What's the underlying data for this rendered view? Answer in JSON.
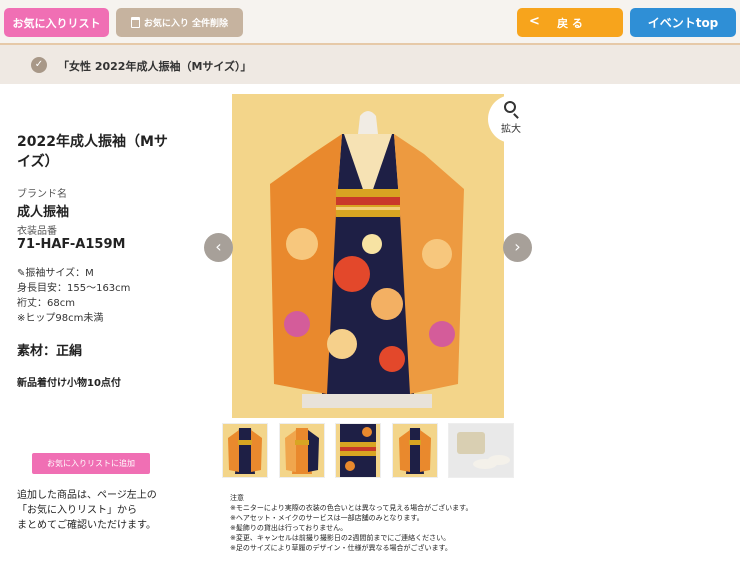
{
  "header": {
    "favorites_label": "お気に入りリスト",
    "clear_all_label": "お気に入り 全件削除",
    "back_label": "戻 る",
    "back_chevron": "<",
    "event_top_label": "イベントtop"
  },
  "breadcrumb": {
    "check": "✓",
    "text": "「女性 2022年成人振袖（Mサイズ）」"
  },
  "product": {
    "title": "2022年成人振袖（Mサイズ）",
    "brand_label": "ブランド名",
    "brand": "成人振袖",
    "code_label": "衣装品番",
    "code": "71-HAF-A159M",
    "specs": [
      "✎振袖サイズ：M",
      "身長目安：155〜163cm",
      "裄丈：68cm",
      "※ヒップ98cm未満"
    ],
    "material": "素材：正絹",
    "includes": "新品着付け小物10点付"
  },
  "gallery": {
    "zoom_label": "拡大",
    "prev": "‹",
    "next": "›",
    "thumbnails": [
      "kimono-front",
      "kimono-front-2",
      "kimono-obi",
      "kimono-full",
      "zori-bag"
    ]
  },
  "favorites": {
    "add_button": "お気に入りリストに追加",
    "note": [
      "追加した商品は、ページ左上の",
      "「お気に入りリスト」から",
      "まとめてご確認いただけます。"
    ]
  },
  "notes": {
    "heading": "注意",
    "lines": [
      "※モニターにより実際の衣装の色合いとは異なって見える場合がございます。",
      "※ヘアセット・メイクのサービスは一部店舗のみとなります。",
      "※髪飾りの貸出は行っておりません。",
      "※変更、キャンセルは前撮り撮影日の2週間前までにご連絡ください。",
      "※足のサイズにより草履のデザイン・仕様が異なる場合がございます。"
    ]
  },
  "colors": {
    "pink": "#f06fb4",
    "orange": "#f7a41c",
    "blue": "#2f8fd6",
    "beige": "#c6b39f",
    "kimono_navy": "#1e1f45",
    "kimono_orange": "#e9892d",
    "backdrop": "#f3d58a"
  }
}
